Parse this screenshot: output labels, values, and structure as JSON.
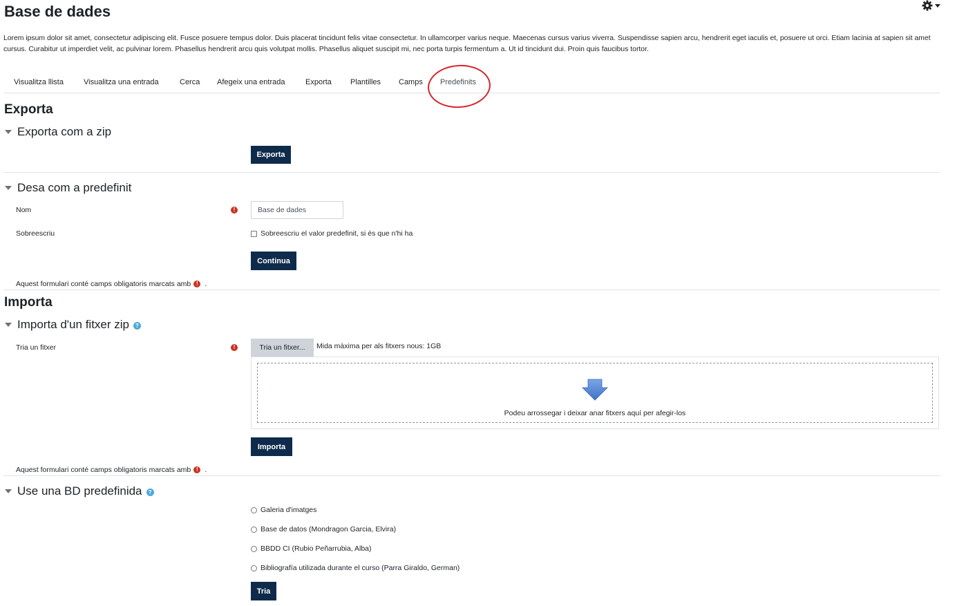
{
  "page": {
    "title": "Base de dades",
    "description": "Lorem ipsum dolor sit amet, consectetur adipiscing elit. Fusce posuere tempus dolor. Duis placerat tincidunt felis vitae consectetur. In ullamcorper varius neque. Maecenas cursus varius viverra. Suspendisse sapien arcu, hendrerit eget iaculis et, posuere ut orci. Etiam lacinia at sapien sit amet cursus. Curabitur ut imperdiet velit, ac pulvinar lorem. Phasellus hendrerit arcu quis volutpat mollis. Phasellus aliquet suscipit mi, nec porta turpis fermentum a. Ut id tincidunt dui. Proin quis faucibus tortor."
  },
  "header": {
    "settings_icon": "gear-icon",
    "settings_caret_icon": "caret-down-icon"
  },
  "tabs": [
    {
      "label": "Visualitza llista"
    },
    {
      "label": "Visualitza una entrada"
    },
    {
      "label": "Cerca"
    },
    {
      "label": "Afegeix una entrada"
    },
    {
      "label": "Exporta"
    },
    {
      "label": "Plantilles"
    },
    {
      "label": "Camps"
    },
    {
      "label": "Predefinits",
      "active": true
    }
  ],
  "annotation": {
    "color": "#d9232d",
    "target": "Predefinits"
  },
  "export": {
    "heading": "Exporta",
    "zip": {
      "legend": "Exporta com a zip",
      "button": "Exporta"
    },
    "save": {
      "legend": "Desa com a predefinit",
      "name_label": "Nom",
      "name_value": "Base de dades",
      "overwrite_label": "Sobreescriu",
      "overwrite_text": "Sobreescriu el valor predefinit, si és que n'hi ha",
      "overwrite_checked": false,
      "button": "Continua",
      "required_note": "Aquest formulari conté camps obligatoris marcats amb",
      "required_note_end": "."
    }
  },
  "import": {
    "heading": "Importa",
    "zip": {
      "legend": "Importa d'un fitxer zip",
      "file_label": "Tria un fitxer",
      "file_button": "Tria un fitxer...",
      "max_size": "Mida màxima per als fitxers nous: 1GB",
      "dropzone_text": "Podeu arrossegar i deixar anar fitxers aquí per afegir-los",
      "button": "Importa",
      "required_note": "Aquest formulari conté camps obligatoris marcats amb",
      "required_note_end": "."
    },
    "preset": {
      "legend": "Use una BD predefinida",
      "options": [
        {
          "label": "Galeria d'imatges"
        },
        {
          "label": "Base de datos (Mondragon Garcia, Elvira)"
        },
        {
          "label": "BBDD CI (Rubio Peñarrubia, Alba)"
        },
        {
          "label": "Bibliografía utilizada durante el curso (Parra Giraldo, German)"
        }
      ],
      "button": "Tria"
    }
  },
  "glyphs": {
    "required": "!",
    "help": "?"
  },
  "colors": {
    "button": "#0f2b4b",
    "required": "#ca3120",
    "help": "#4fa8d8",
    "dropzone_arrow": "#5b8ed6"
  }
}
